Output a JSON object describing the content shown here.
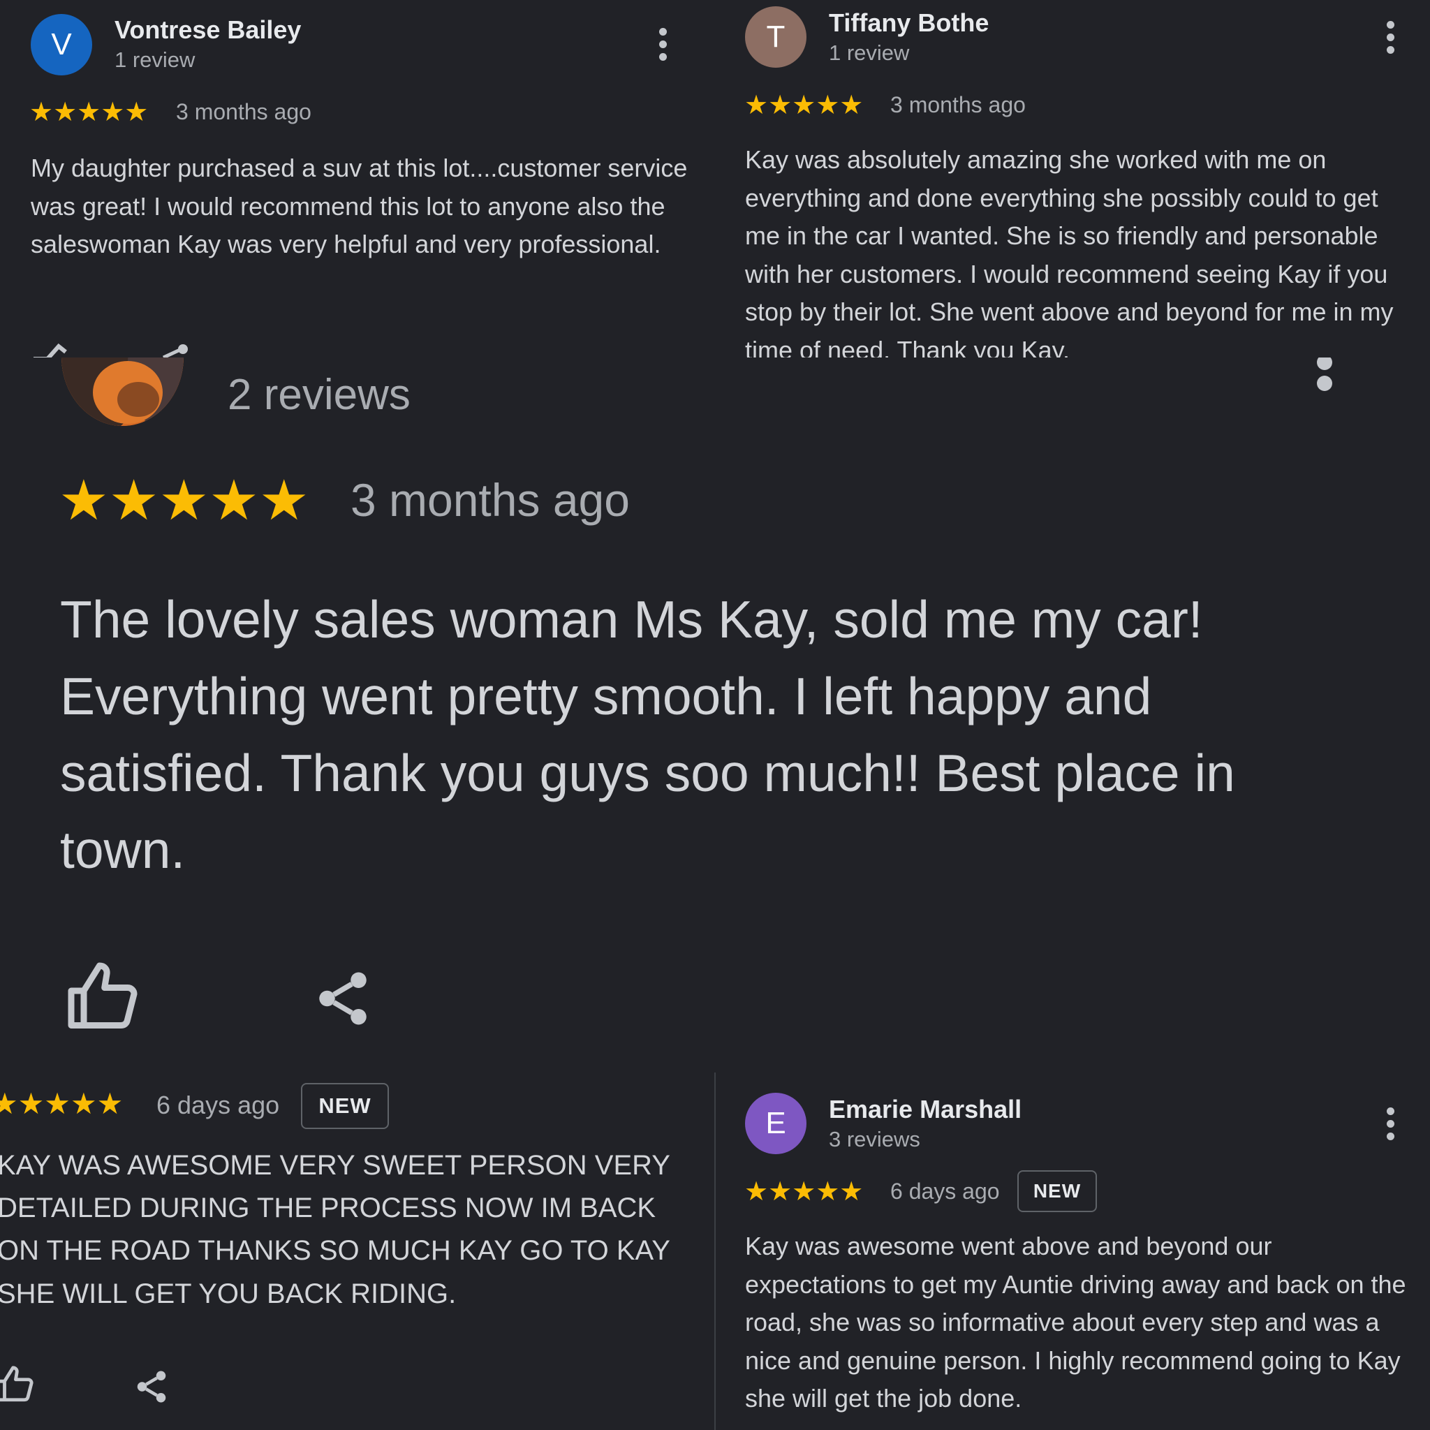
{
  "reviews": {
    "vontrese": {
      "avatar_letter": "V",
      "avatar_color": "#1565c0",
      "name": "Vontrese Bailey",
      "count": "1 review",
      "rating": "★★★★★",
      "ago": "3 months ago",
      "text": "My daughter purchased a suv at this lot....customer service was great! I would recommend this lot to anyone also the saleswoman Kay was very helpful and very professional."
    },
    "tiffany": {
      "avatar_letter": "T",
      "avatar_color": "#8d6e63",
      "name": "Tiffany Bothe",
      "count": "1 review",
      "rating": "★★★★★",
      "ago": "3 months ago",
      "text": "Kay was absolutely amazing she worked with me on everything and done everything she possibly could to get me in the car I wanted. She is so friendly and personable with her customers. I would recommend seeing Kay if you stop by their lot. She went above and beyond for me in my time of need. Thank you Kay."
    },
    "zoomed": {
      "count": "2 reviews",
      "rating": "★★★★★",
      "ago": "3 months ago",
      "text": "The lovely sales woman Ms Kay, sold me my car! Everything went pretty smooth. I left happy and satisfied. Thank you guys soo much!! Best place in town."
    },
    "caps": {
      "rating": "★★★★★",
      "ago": "6 days ago",
      "badge": "NEW",
      "lines": [
        "KAY WAS AWESOME VERY SWEET PERSON VERY",
        "DETAILED DURING THE PROCESS NOW IM BACK",
        "ON THE ROAD THANKS SO MUCH KAY GO TO KAY",
        "SHE WILL GET YOU BACK RIDING."
      ]
    },
    "emarie": {
      "avatar_letter": "E",
      "avatar_color": "#7e57c2",
      "name": "Emarie Marshall",
      "count": "3 reviews",
      "rating": "★★★★★",
      "ago": "6 days ago",
      "badge": "NEW",
      "text": "Kay was awesome went above and beyond our expectations to get my Auntie driving away and back on the road, she was so informative about every step and was a nice and genuine person. I highly recommend going to Kay she will get the job done."
    }
  },
  "colors": {
    "star": "#fbbc04",
    "background": "#212227",
    "muted_text": "#a9acb1"
  },
  "icons": [
    "more-vert-icon",
    "thumbs-up-icon",
    "share-icon"
  ]
}
